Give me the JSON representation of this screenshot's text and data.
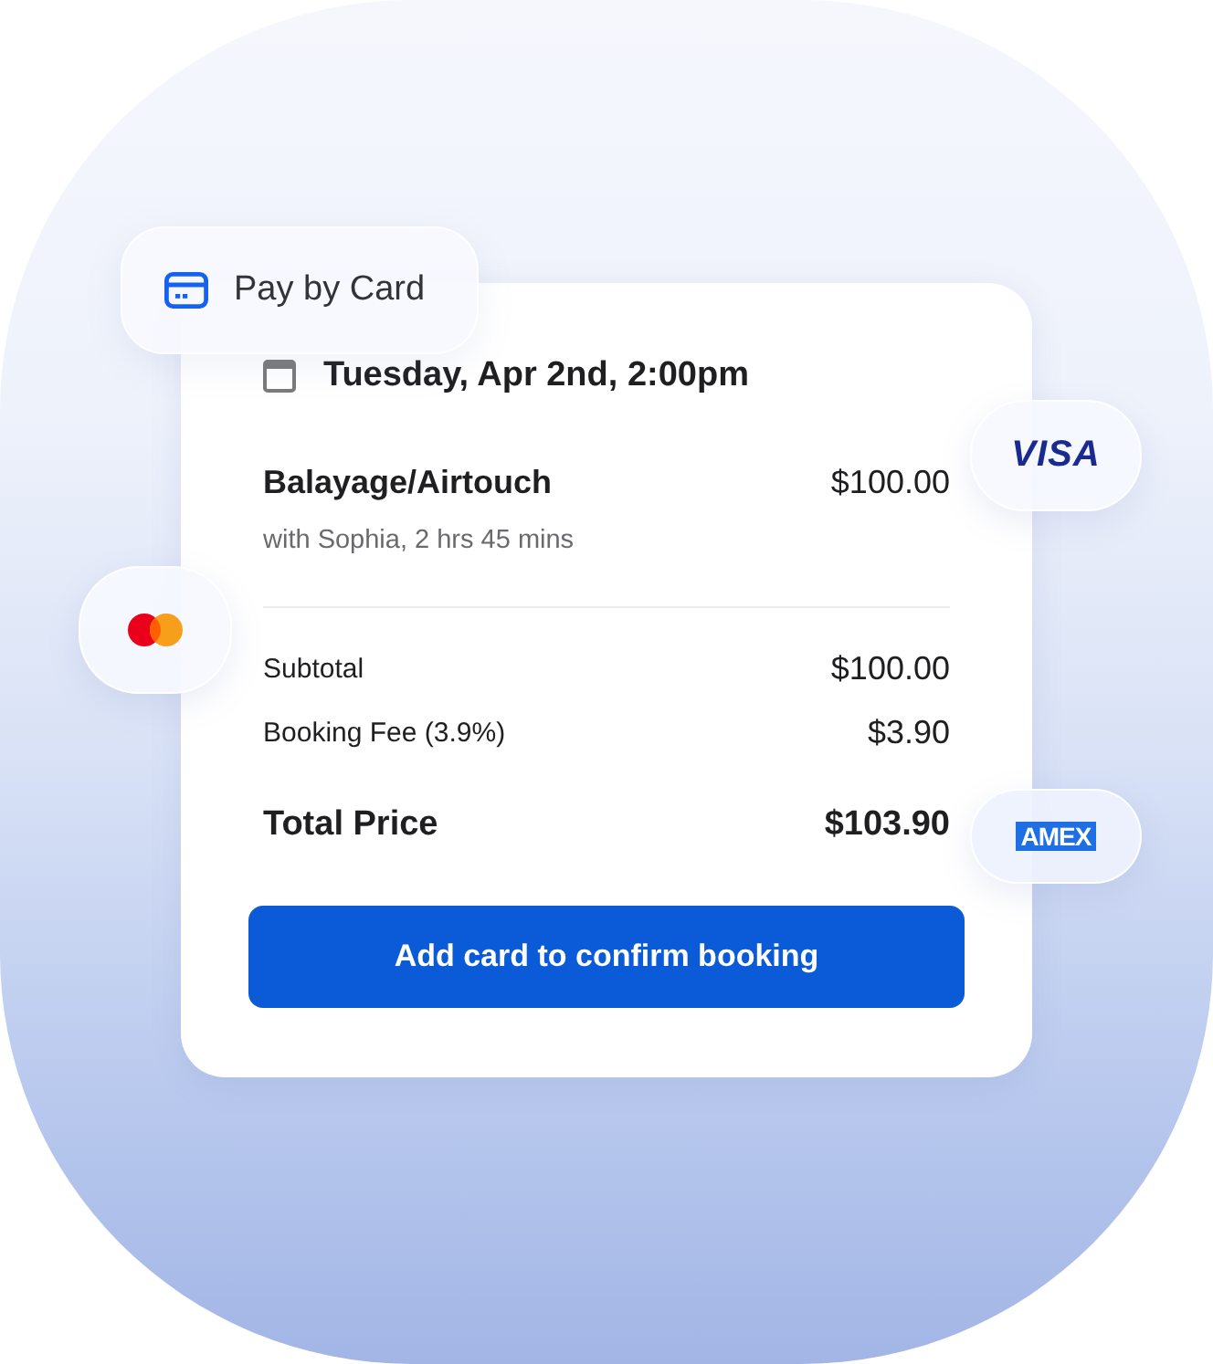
{
  "payment_header": {
    "label": "Pay by Card"
  },
  "appointment": {
    "date": "Tuesday, Apr 2nd, 2:00pm"
  },
  "service": {
    "name": "Balayage/Airtouch",
    "price": "$100.00",
    "details": "with Sophia, 2 hrs 45 mins"
  },
  "summary": [
    {
      "kind": "line",
      "label": "Subtotal",
      "amount": "$100.00"
    },
    {
      "kind": "line",
      "label": "Booking Fee (3.9%)",
      "amount": "$3.90"
    },
    {
      "kind": "total",
      "label": "Total Price",
      "amount": "$103.90"
    }
  ],
  "confirm_button": {
    "label": "Add card to confirm booking"
  },
  "card_badges": [
    {
      "kind": "visa",
      "label": "VISA"
    },
    {
      "kind": "mastercard"
    },
    {
      "kind": "amex",
      "label": "AMEX"
    }
  ]
}
